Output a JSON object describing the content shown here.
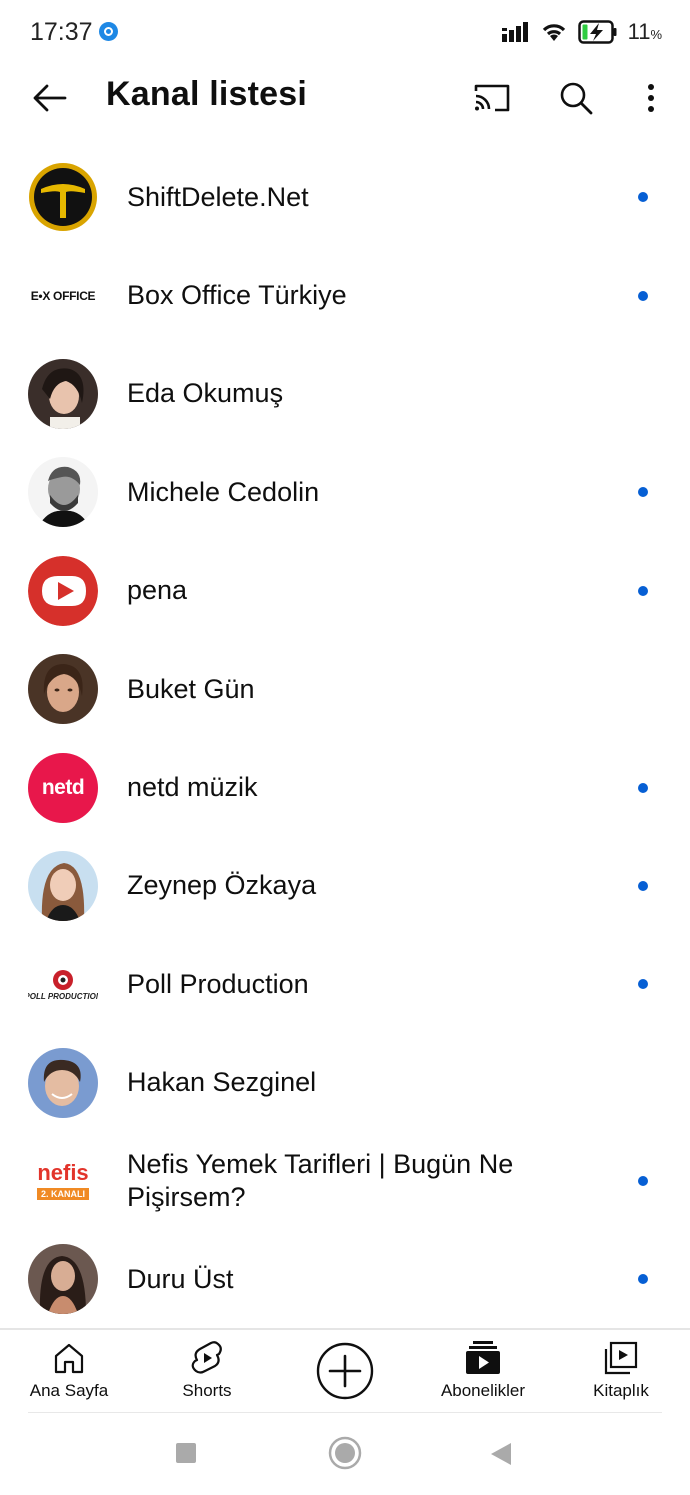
{
  "status_bar": {
    "time": "17:37",
    "battery": "11",
    "battery_unit": "%"
  },
  "app_bar": {
    "title": "Kanal listesi"
  },
  "channels": [
    {
      "name": "ShiftDelete.Net",
      "new": true,
      "avatar": "shiftdelete-logo"
    },
    {
      "name": "Box Office Türkiye",
      "new": true,
      "avatar": "boxoffice-logo",
      "logo_text": "E•X OFFICE"
    },
    {
      "name": "Eda Okumuş",
      "new": false,
      "avatar": "photo"
    },
    {
      "name": "Michele Cedolin",
      "new": true,
      "avatar": "photo"
    },
    {
      "name": "pena",
      "new": true,
      "avatar": "pena-logo"
    },
    {
      "name": "Buket Gün",
      "new": false,
      "avatar": "photo"
    },
    {
      "name": "netd müzik",
      "new": true,
      "avatar": "netd-logo",
      "logo_text": "netd"
    },
    {
      "name": "Zeynep Özkaya",
      "new": true,
      "avatar": "photo"
    },
    {
      "name": "Poll Production",
      "new": true,
      "avatar": "poll-logo",
      "logo_text": "POLL PRODUCTION"
    },
    {
      "name": "Hakan Sezginel",
      "new": false,
      "avatar": "photo"
    },
    {
      "name": "Nefis Yemek Tarifleri | Bugün Ne Pişirsem?",
      "new": true,
      "avatar": "nefis-logo",
      "logo_text": "nefis",
      "logo_sub": "2. KANALI"
    },
    {
      "name": "Duru Üst",
      "new": true,
      "avatar": "photo"
    }
  ],
  "bottom_nav": {
    "home": "Ana Sayfa",
    "shorts": "Shorts",
    "subscriptions": "Abonelikler",
    "library": "Kitaplık"
  },
  "colors": {
    "accent_dot": "#065fd4",
    "text": "#0f0f0f"
  }
}
